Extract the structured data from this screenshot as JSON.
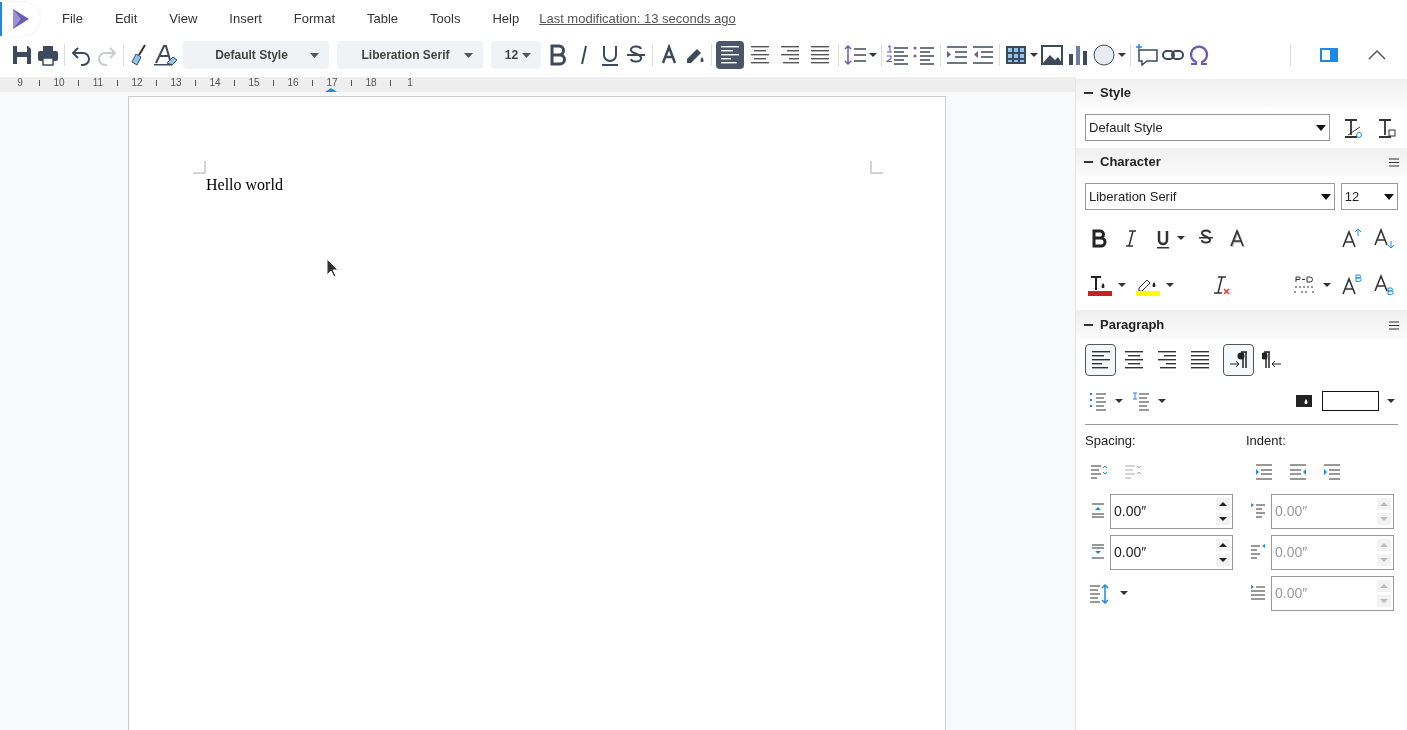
{
  "menu": [
    {
      "label": "File"
    },
    {
      "label": "Edit"
    },
    {
      "label": "View"
    },
    {
      "label": "Insert"
    },
    {
      "label": "Format"
    },
    {
      "label": "Table"
    },
    {
      "label": "Tools"
    },
    {
      "label": "Help"
    }
  ],
  "last_modification": {
    "label": "Last modification:",
    "time": "13 seconds ago"
  },
  "toolbar": {
    "redo_disabled": true,
    "style": "Default Style",
    "font": "Liberation Serif",
    "size": "12",
    "alignment": [
      {
        "kind": "left",
        "selected": true
      },
      {
        "kind": "center",
        "selected": false
      },
      {
        "kind": "right",
        "selected": false
      },
      {
        "kind": "justify",
        "selected": false
      }
    ]
  },
  "ruler": {
    "labels": [
      "9",
      "10",
      "11",
      "12",
      "13",
      "14",
      "15",
      "16",
      "17",
      "18",
      "1"
    ]
  },
  "document": {
    "text": "Hello world"
  },
  "sidebar": {
    "style": {
      "title": "Style",
      "value": "Default Style"
    },
    "character": {
      "title": "Character",
      "font": "Liberation Serif",
      "size": "12"
    },
    "paragraph": {
      "title": "Paragraph",
      "alignment": [
        {
          "kind": "left",
          "selected": true
        },
        {
          "kind": "center",
          "selected": false
        },
        {
          "kind": "right",
          "selected": false
        },
        {
          "kind": "justify",
          "selected": false
        }
      ],
      "direction": [
        {
          "kind": "ltr",
          "selected": true
        },
        {
          "kind": "rtl",
          "selected": false
        }
      ],
      "spacing_label": "Spacing:",
      "indent_label": "Indent:",
      "spacing_fields": [
        {
          "kind": "above",
          "value": "0.00″",
          "disabled": false
        },
        {
          "kind": "below",
          "value": "0.00″",
          "disabled": false
        }
      ],
      "indent_fields": [
        {
          "kind": "before",
          "value": "0.00″",
          "disabled": true
        },
        {
          "kind": "after",
          "value": "0.00″",
          "disabled": true
        },
        {
          "kind": "first",
          "value": "0.00″",
          "disabled": true
        }
      ]
    }
  }
}
